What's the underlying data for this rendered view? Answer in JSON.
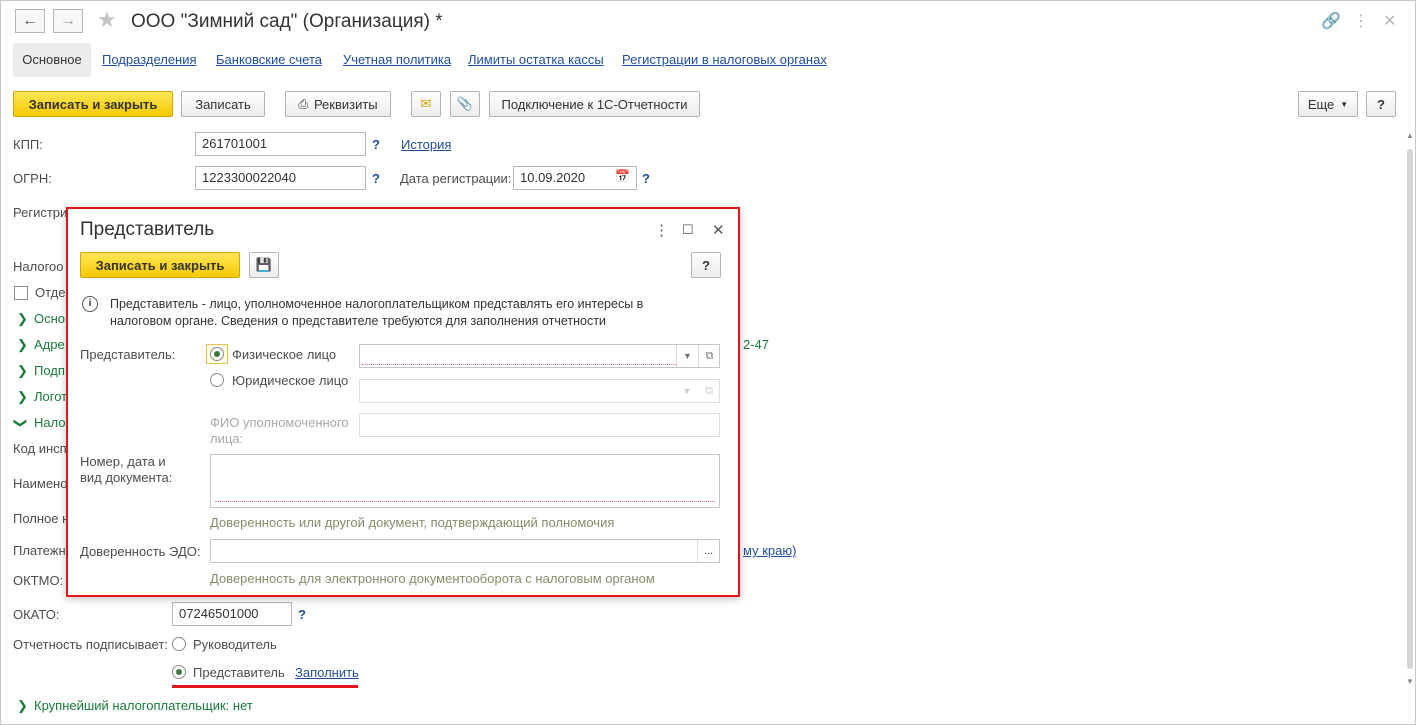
{
  "window": {
    "title": "ООО \"Зимний сад\" (Организация) *"
  },
  "tabs": [
    {
      "label": "Основное"
    },
    {
      "label": "Подразделения"
    },
    {
      "label": "Банковские счета"
    },
    {
      "label": "Учетная политика"
    },
    {
      "label": "Лимиты остатка кассы"
    },
    {
      "label": "Регистрации в налоговых органах"
    }
  ],
  "toolbar": {
    "save_close": "Записать и закрыть",
    "save": "Записать",
    "requisites": "Реквизиты",
    "connect": "Подключение к 1С-Отчетности",
    "more": "Еще",
    "help": "?"
  },
  "form": {
    "kpp_label": "КПП:",
    "kpp_value": "261701001",
    "history_link": "История",
    "ogrn_label": "ОГРН:",
    "ogrn_value": "1223300022040",
    "reg_date_label": "Дата регистрации:",
    "reg_date_value": "10.09.2020",
    "reg_label": "Регистри",
    "tax_label": "Налогоо",
    "separate_label": "Отде",
    "section_basic": "Осно",
    "section_address": "Адре",
    "address_tail": "2-47",
    "section_signatures": "Подп",
    "section_logo": "Логот",
    "section_tax": "Нало",
    "inspection_code": "Код инсп",
    "name_label": "Наимено",
    "fullname_label": "Полное н",
    "payment_label": "Платежн",
    "payment_tail": "му краю)",
    "oktmo_label": "ОКТМО:",
    "okato_label": "ОКАТО:",
    "okato_value": "07246501000",
    "signer_label": "Отчетность подписывает:",
    "signer_head": "Руководитель",
    "signer_rep": "Представитель",
    "fill_link": "Заполнить",
    "large_taxpayer": "Крупнейший налогоплательщик: нет"
  },
  "dialog": {
    "title": "Представитель",
    "save_close": "Записать и закрыть",
    "help": "?",
    "info_line1": "Представитель - лицо, уполномоченное налогоплательщиком представлять его интересы в",
    "info_line2": "налоговом органе. Сведения о представителе требуются для заполнения отчетности",
    "rep_label": "Представитель:",
    "individual": "Физическое лицо",
    "legal": "Юридическое лицо",
    "fio_line1": "ФИО уполномоченного",
    "fio_line2": "лица:",
    "doc_line1": "Номер, дата и",
    "doc_line2": "вид документа:",
    "doc_hint": "Доверенность или другой документ, подтверждающий полномочия",
    "edo_label": "Доверенность ЭДО:",
    "edo_hint": "Доверенность для электронного документооборота с налоговым органом"
  }
}
